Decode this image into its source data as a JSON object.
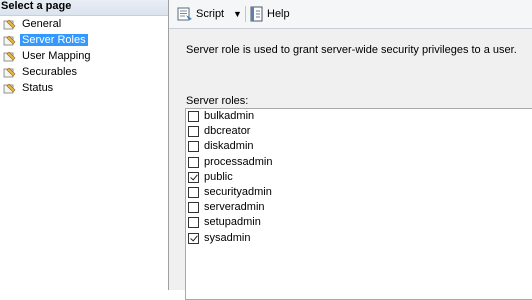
{
  "left_pane": {
    "header": "Select a page",
    "pages": [
      {
        "label": "General",
        "selected": false
      },
      {
        "label": "Server Roles",
        "selected": true
      },
      {
        "label": "User Mapping",
        "selected": false
      },
      {
        "label": "Securables",
        "selected": false
      },
      {
        "label": "Status",
        "selected": false
      }
    ]
  },
  "toolbar": {
    "script_label": "Script",
    "dropdown_glyph": "▼",
    "help_label": "Help"
  },
  "main": {
    "description": "Server role is used to grant server-wide security privileges to a user.",
    "roles_label": "Server roles:",
    "roles": [
      {
        "name": "bulkadmin",
        "checked": false
      },
      {
        "name": "dbcreator",
        "checked": false
      },
      {
        "name": "diskadmin",
        "checked": false
      },
      {
        "name": "processadmin",
        "checked": false
      },
      {
        "name": "public",
        "checked": true
      },
      {
        "name": "securityadmin",
        "checked": false
      },
      {
        "name": "serveradmin",
        "checked": false
      },
      {
        "name": "setupadmin",
        "checked": false
      },
      {
        "name": "sysadmin",
        "checked": true
      }
    ]
  },
  "colors": {
    "selection": "#3399ff",
    "content_bg": "#f0f0f0"
  }
}
